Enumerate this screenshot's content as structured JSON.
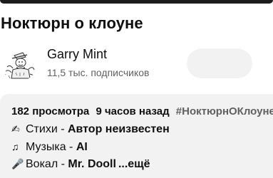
{
  "video": {
    "title": "Ноктюрн о клоуне"
  },
  "channel": {
    "name": "Garry Mint",
    "subscribers": "11,5 тыс. подписчиков",
    "avatar_icon": "clown-caricature-avatar"
  },
  "description": {
    "views": "182 просмотра",
    "time": "9 часов назад",
    "hashtag": "#НоктюрнОКлоуне",
    "lines": [
      {
        "icon": "writing-hand-icon",
        "label": "Стихи - ",
        "value": "Автор неизвестен"
      },
      {
        "icon": "music-notes-icon",
        "label": "Музыка - ",
        "value": "AI"
      },
      {
        "icon": "microphone-icon",
        "label": "Вокал - ",
        "value": "Mr. Dooll"
      }
    ],
    "more_label": "...ещё"
  }
}
